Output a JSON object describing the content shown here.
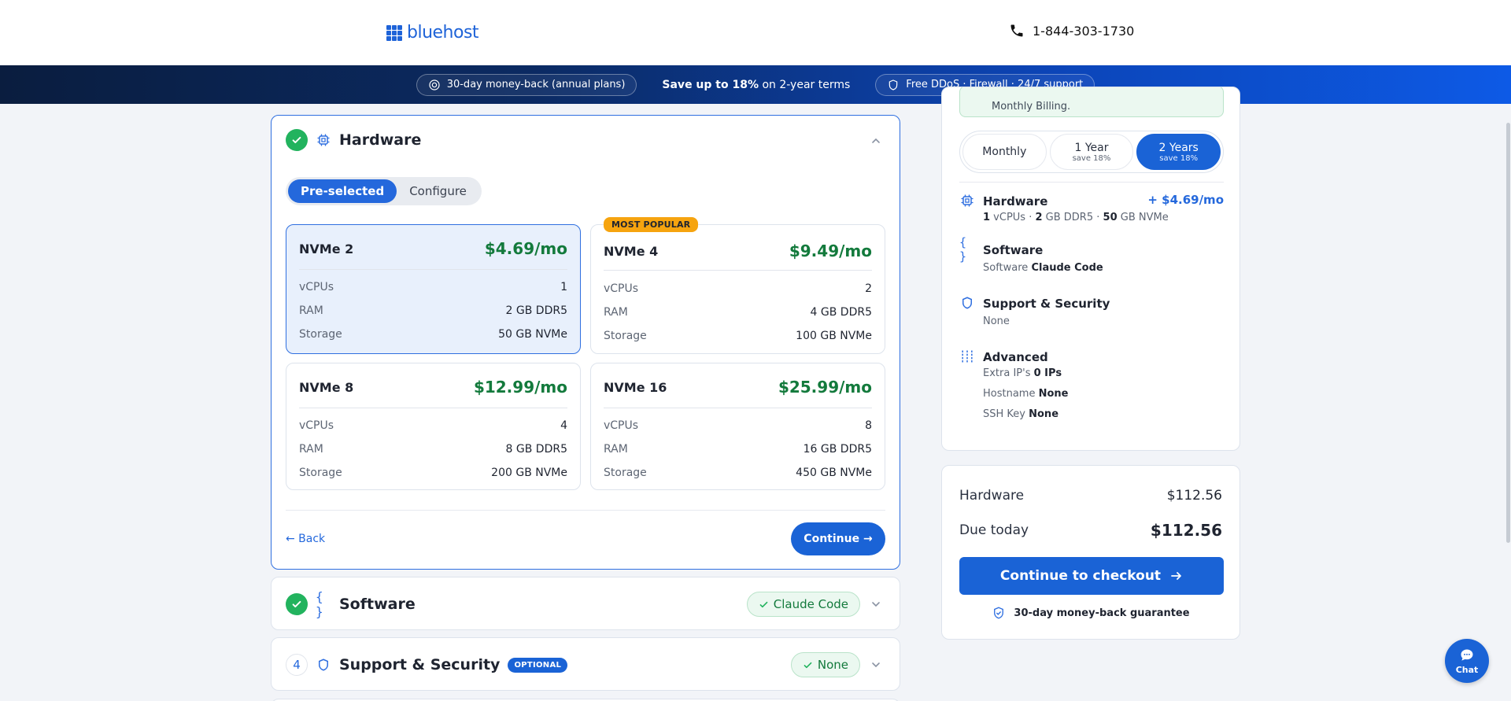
{
  "header": {
    "brand": "bluehost",
    "phone": "1-844-303-1730"
  },
  "promo": {
    "money_back": "30-day money-back (annual plans)",
    "save_bold": "Save up to 18%",
    "save_rest": " on 2-year terms",
    "protection": "Free DDoS · Firewall · 24/7 support"
  },
  "hardware": {
    "title": "Hardware",
    "toggle": [
      "Pre-selected",
      "Configure"
    ],
    "plans": [
      {
        "name": "NVMe 2",
        "price": "$4.69/mo",
        "vcpus": "1",
        "ram": "2 GB DDR5",
        "storage": "50 GB NVMe",
        "badge": ""
      },
      {
        "name": "NVMe 4",
        "price": "$9.49/mo",
        "vcpus": "2",
        "ram": "4 GB DDR5",
        "storage": "100 GB NVMe",
        "badge": "MOST POPULAR"
      },
      {
        "name": "NVMe 8",
        "price": "$12.99/mo",
        "vcpus": "4",
        "ram": "8 GB DDR5",
        "storage": "200 GB NVMe",
        "badge": ""
      },
      {
        "name": "NVMe 16",
        "price": "$25.99/mo",
        "vcpus": "8",
        "ram": "16 GB DDR5",
        "storage": "450 GB NVMe",
        "badge": ""
      }
    ],
    "labels": {
      "vcpus": "vCPUs",
      "ram": "RAM",
      "storage": "Storage"
    },
    "back": "← Back",
    "continue": "Continue →"
  },
  "software_section": {
    "title": "Software",
    "status": "Claude Code"
  },
  "support_section": {
    "step": "4",
    "title": "Support & Security",
    "badge": "OPTIONAL",
    "status": "None"
  },
  "summary": {
    "notice": "Monthly Billing.",
    "terms": [
      {
        "label": "Monthly",
        "sub": ""
      },
      {
        "label": "1 Year",
        "sub": "save 18%"
      },
      {
        "label": "2 Years",
        "sub": "save 18%"
      }
    ],
    "hardware": {
      "title": "Hardware",
      "price": "+ $4.69/mo",
      "vcpu_val": "1",
      "vcpu_label": " vCPUs",
      "sep1": " · ",
      "ram_val": "2",
      "ram_label": " GB DDR5",
      "sep2": " · ",
      "storage_val": "50",
      "storage_label": " GB NVMe"
    },
    "software": {
      "title": "Software",
      "prefix": "Software ",
      "value": "Claude Code"
    },
    "support": {
      "title": "Support & Security",
      "value": "None"
    },
    "advanced": {
      "title": "Advanced",
      "extra_ip_label": "Extra IP's ",
      "extra_ip_value": "0 IPs",
      "hostname_label": "Hostname ",
      "hostname_value": "None",
      "ssh_label": "SSH Key ",
      "ssh_value": "None"
    }
  },
  "totals": {
    "hardware_label": "Hardware",
    "hardware_value": "$112.56",
    "due_label": "Due today",
    "due_value": "$112.56",
    "checkout": "Continue to checkout",
    "guarantee": "30-day money-back guarantee"
  },
  "chat": {
    "label": "Chat"
  },
  "colors": {
    "accent": "#1a63d6",
    "price_green": "#137a3c",
    "success": "#22b35e",
    "popular": "#f6a40f"
  }
}
